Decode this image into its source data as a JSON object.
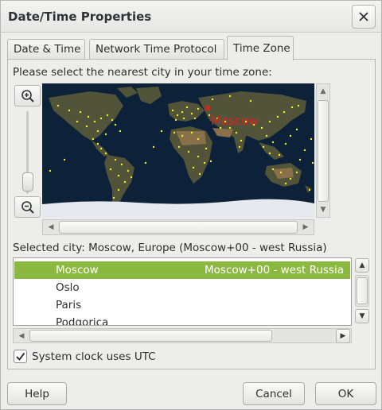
{
  "window": {
    "title": "Date/Time Properties"
  },
  "tabs": [
    {
      "label": "Date & Time"
    },
    {
      "label": "Network Time Protocol"
    },
    {
      "label": "Time Zone"
    }
  ],
  "timezone": {
    "prompt": "Please select the nearest city in your time zone:",
    "map_marker_label": "Moscow",
    "selected_city_text": "Selected city: Moscow, Europe (Moscow+00 - west Russia)",
    "cities": [
      {
        "name": "Moscow",
        "zone": "Moscow+00 - west Russia",
        "selected": true
      },
      {
        "name": "Oslo",
        "zone": ""
      },
      {
        "name": "Paris",
        "zone": ""
      },
      {
        "name": "Podgorica",
        "zone": ""
      }
    ],
    "utc_checkbox_label": "System clock uses UTC",
    "utc_checked": true
  },
  "buttons": {
    "help": "Help",
    "cancel": "Cancel",
    "ok": "OK"
  },
  "icons": {
    "close": "close-icon",
    "zoom_in": "zoom-in-icon",
    "zoom_out": "zoom-out-icon",
    "check": "check-icon"
  },
  "colors": {
    "selection": "#8bb83e",
    "map_marker": "#e32020",
    "city_dot": "#f3ef2c"
  }
}
